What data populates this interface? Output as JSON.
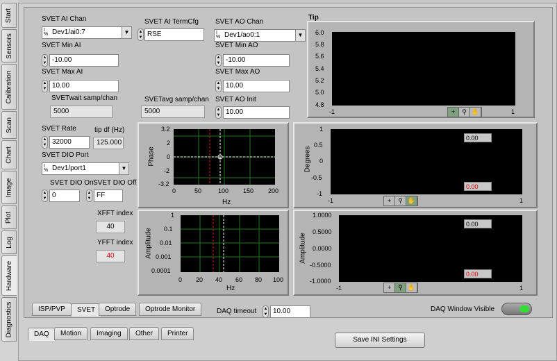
{
  "side_tabs": [
    "Start",
    "Sensors",
    "Calibration",
    "Scan",
    "Chart",
    "Image",
    "Plot",
    "Log",
    "Hardware",
    "Diagnostics"
  ],
  "controls": {
    "ai_chan_label": "SVET AI Chan",
    "ai_chan_value": "Dev1/ai0:7",
    "ai_termcfg_label": "SVET AI TermCfg",
    "ai_termcfg_value": "RSE",
    "ao_chan_label": "SVET AO Chan",
    "ao_chan_value": "Dev1/ao0:1",
    "min_ai_label": "SVET Min AI",
    "min_ai_value": "-10.00",
    "max_ai_label": "SVET Max AI",
    "max_ai_value": "10.00",
    "min_ao_label": "SVET Min AO",
    "min_ao_value": "-10.00",
    "max_ao_label": "SVET Max AO",
    "max_ao_value": "10.00",
    "wait_samp_label": "SVETwait samp/chan",
    "wait_samp_value": "5000",
    "avg_samp_label": "SVETavg samp/chan",
    "avg_samp_value": "5000",
    "ao_init_label": "SVET AO Init",
    "ao_init_value": "10.00",
    "rate_label": "SVET Rate",
    "rate_value": "32000",
    "tip_df_label": "tip df (Hz)",
    "tip_df_value": "125.000",
    "dio_port_label": "SVET DIO Port",
    "dio_port_value": "Dev1/port1",
    "dio_on_label": "SVET DIO On",
    "dio_on_value": "0",
    "dio_off_label": "SVET DIO Off",
    "dio_off_value": "FF",
    "xfft_label": "XFFT index",
    "xfft_value": "40",
    "yfft_label": "YFFT index",
    "yfft_value": "40"
  },
  "tip_graph": {
    "title": "Tip",
    "yticks": [
      "6.0",
      "5.8",
      "5.6",
      "5.4",
      "5.2",
      "5.0",
      "4.8"
    ],
    "xticks": [
      "-1",
      "1"
    ]
  },
  "phase_graph": {
    "ylabel": "Phase",
    "xlabel": "Hz",
    "yticks": [
      "3.2",
      "2",
      "0",
      "-2",
      "-3.2"
    ],
    "xticks": [
      "0",
      "50",
      "100",
      "150",
      "200"
    ]
  },
  "amp_graph": {
    "ylabel": "Amplitude",
    "xlabel": "Hz",
    "yticks": [
      "1",
      "0.1",
      "0.01",
      "0.001",
      "0.0001"
    ],
    "xticks": [
      "0",
      "20",
      "40",
      "60",
      "80",
      "100"
    ]
  },
  "deg_graph": {
    "ylabel": "Degrees",
    "yticks": [
      "1",
      "0.5",
      "0",
      "-0.5",
      "-1"
    ],
    "xticks": [
      "-1",
      "1"
    ],
    "cursor1": "0.00",
    "cursor2": "0.00"
  },
  "amp2_graph": {
    "ylabel": "Amplitude",
    "yticks": [
      "1.0000",
      "0.5000",
      "0.0000",
      "-0.5000",
      "-1.0000"
    ],
    "xticks": [
      "-1",
      "1"
    ],
    "cursor1": "0.00",
    "cursor2": "0.00"
  },
  "inner_tabs": [
    "ISP/PVP",
    "SVET",
    "Optrode",
    "Optrode Monitor"
  ],
  "daq_timeout_label": "DAQ timeout",
  "daq_timeout_value": "10.00",
  "daq_window_label": "DAQ Window Visible",
  "bottom_tabs": [
    "DAQ",
    "Motion",
    "Imaging",
    "Other",
    "Printer"
  ],
  "save_button": "Save INI Settings",
  "colors": {
    "plot_bg": "#000000",
    "grid": "#1e7a1e",
    "cursor_red": "#cc2222",
    "led_on": "#33dd33",
    "red_text": "#dd0000"
  }
}
